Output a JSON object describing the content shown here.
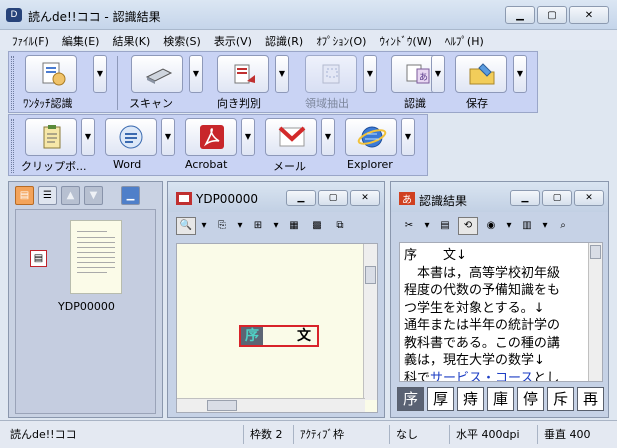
{
  "window": {
    "title": "読んde!!ココ - 認識結果",
    "app_icon": "app-logo-icon"
  },
  "menu": [
    "ﾌｧｲﾙ(F)",
    "編集(E)",
    "結果(K)",
    "検索(S)",
    "表示(V)",
    "認識(R)",
    "ｵﾌﾟｼｮﾝ(O)",
    "ｳｨﾝﾄﾞｳ(W)",
    "ﾍﾙﾌﾟ(H)"
  ],
  "toolbar1": [
    {
      "label": "ﾜﾝﾀｯﾁ認識",
      "icon": "one-touch-icon",
      "disabled": false
    },
    {
      "label": "スキャン",
      "icon": "scanner-icon",
      "disabled": false
    },
    {
      "label": "向き判別",
      "icon": "orientation-icon",
      "disabled": false
    },
    {
      "label": "領域抽出",
      "icon": "region-extract-icon",
      "disabled": true
    },
    {
      "label": "認識",
      "icon": "recognize-icon",
      "disabled": false
    },
    {
      "label": "保存",
      "icon": "save-icon",
      "disabled": false
    }
  ],
  "toolbar2": [
    {
      "label": "クリップボ...",
      "icon": "clipboard-icon"
    },
    {
      "label": "Word",
      "icon": "word-icon"
    },
    {
      "label": "Acrobat",
      "icon": "acrobat-icon"
    },
    {
      "label": "メール",
      "icon": "mail-icon"
    },
    {
      "label": "Explorer",
      "icon": "explorer-icon"
    }
  ],
  "thumbnail": {
    "name": "YDP00000"
  },
  "image_pane": {
    "title": "YDP00000",
    "sel_first": "序",
    "sel_second": "文"
  },
  "result_pane": {
    "title": "認識結果",
    "lines": [
      "序　　文↓",
      "　本書は，高等学校初年級",
      "程度の代数の予備知識をも",
      "つ学生を対象とする。↓",
      "通年または半年の統計学の",
      "教科書である。この種の講",
      "義は，現在大学の数学↓"
    ],
    "last_line_pre": "科で",
    "last_line_link": "サービス・コース",
    "last_line_post": "とし",
    "candidates": [
      "序",
      "厚",
      "痔",
      "庫",
      "停",
      "斥",
      "再"
    ]
  },
  "status": {
    "app": "読んde!!ココ",
    "frames": "枠数 2",
    "active": "ｱｸﾃｨﾌﾞ枠",
    "none": "なし",
    "horizontal": "水平 400dpi",
    "vertical": "垂直 400"
  },
  "colors": {
    "toolbar_bg": "#c9d3f4",
    "selection": "#d8232a",
    "link": "#1d3ec4"
  }
}
